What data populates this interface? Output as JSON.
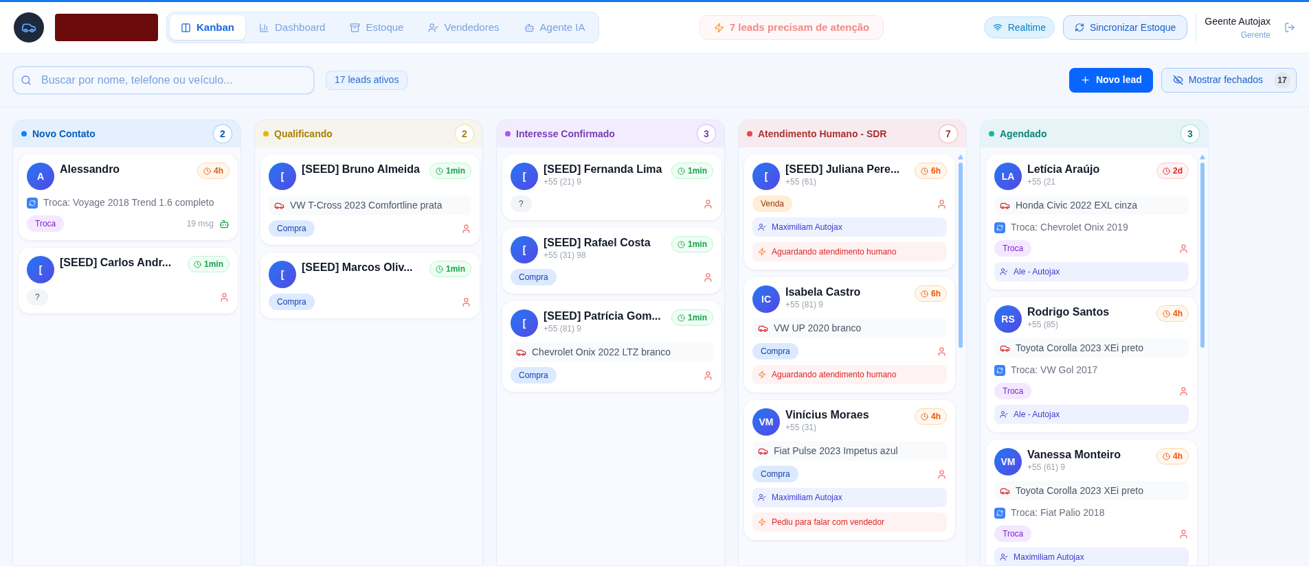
{
  "header": {
    "tabs": [
      {
        "label": "Kanban",
        "selected": true
      },
      {
        "label": "Dashboard",
        "selected": false
      },
      {
        "label": "Estoque",
        "selected": false
      },
      {
        "label": "Vendedores",
        "selected": false
      },
      {
        "label": "Agente IA",
        "selected": false
      }
    ],
    "alert": "7 leads precisam de atenção",
    "realtime": "Realtime",
    "sync": "Sincronizar Estoque",
    "user": {
      "name": "Geente Autojax",
      "role": "Gerente"
    }
  },
  "toolbar": {
    "search": {
      "placeholder": "Buscar por nome, telefone ou veículo..."
    },
    "active_count": "17 leads ativos",
    "new_lead": "Novo lead",
    "show_closed": {
      "label": "Mostrar fechados",
      "count": "17"
    }
  },
  "columns": [
    {
      "title": "Novo Contato",
      "count": "2",
      "color": "#0a84ff",
      "scrollable": false,
      "cards": [
        {
          "kind": "bot",
          "initials": "A",
          "name": "Alessandro",
          "time": {
            "label": "4h",
            "kind": "warn"
          },
          "trade": "Troca: Voyage 2018 Trend 1.6 completo",
          "tag": {
            "label": "Troca",
            "kind": "troca"
          },
          "msgs": "19 msg"
        },
        {
          "kind": "person",
          "initials": "[",
          "name": "[SEED] Carlos Andr...",
          "time": {
            "label": "1min",
            "kind": "ok"
          },
          "tag": {
            "label": "?",
            "kind": "unknown"
          }
        }
      ]
    },
    {
      "title": "Qualificando",
      "count": "2",
      "color": "#eab308",
      "scrollable": false,
      "cards": [
        {
          "kind": "person",
          "initials": "[",
          "name": "[SEED] Bruno Almeida",
          "time": {
            "label": "1min",
            "kind": "ok"
          },
          "vehicle": "VW T-Cross 2023 Comfortline prata",
          "tag": {
            "label": "Compra",
            "kind": "compra"
          }
        },
        {
          "kind": "person",
          "initials": "[",
          "name": "[SEED] Marcos Oliv...",
          "time": {
            "label": "1min",
            "kind": "ok"
          },
          "tag": {
            "label": "Compra",
            "kind": "compra"
          }
        }
      ]
    },
    {
      "title": "Interesse Confirmado",
      "count": "3",
      "color": "#a855f7",
      "scrollable": false,
      "cards": [
        {
          "kind": "person",
          "initials": "[",
          "name": "[SEED] Fernanda Lima",
          "phone": "+55 (21) 9",
          "time": {
            "label": "1min",
            "kind": "ok"
          },
          "tag": {
            "label": "?",
            "kind": "unknown"
          }
        },
        {
          "kind": "person",
          "initials": "[",
          "name": "[SEED] Rafael Costa",
          "phone": "+55 (31) 98",
          "time": {
            "label": "1min",
            "kind": "ok"
          },
          "tag": {
            "label": "Compra",
            "kind": "compra"
          }
        },
        {
          "kind": "person",
          "initials": "[",
          "name": "[SEED] Patrícia Gom...",
          "phone": "+55 (81) 9",
          "time": {
            "label": "1min",
            "kind": "ok"
          },
          "vehicle": "Chevrolet Onix 2022 LTZ branco",
          "tag": {
            "label": "Compra",
            "kind": "compra"
          }
        }
      ]
    },
    {
      "title": "Atendimento Humano - SDR",
      "count": "7",
      "color": "#ef4444",
      "scrollable": true,
      "cards": [
        {
          "kind": "person",
          "initials": "[",
          "name": "[SEED] Juliana Pere...",
          "phone": "+55 (61)",
          "time": {
            "label": "6h",
            "kind": "warn"
          },
          "tag": {
            "label": "Venda",
            "kind": "venda"
          },
          "seller": "Maximiliam Autojax",
          "alert": "Aguardando atendimento humano"
        },
        {
          "kind": "person",
          "initials": "IC",
          "name": "Isabela Castro",
          "phone": "+55 (81) 9",
          "time": {
            "label": "6h",
            "kind": "warn"
          },
          "vehicle": "VW UP 2020 branco",
          "tag": {
            "label": "Compra",
            "kind": "compra"
          },
          "alert": "Aguardando atendimento humano"
        },
        {
          "kind": "person",
          "initials": "VM",
          "name": "Vinícius Moraes",
          "phone": "+55 (31)",
          "time": {
            "label": "4h",
            "kind": "warn"
          },
          "vehicle": "Fiat Pulse 2023 Impetus azul",
          "tag": {
            "label": "Compra",
            "kind": "compra"
          },
          "seller": "Maximiliam Autojax",
          "alert": "Pediu para falar com vendedor"
        }
      ]
    },
    {
      "title": "Agendado",
      "count": "3",
      "color": "#14b8a6",
      "scrollable": true,
      "cards": [
        {
          "kind": "person",
          "initials": "LA",
          "name": "Letícia Araújo",
          "phone": "+55 (21",
          "time": {
            "label": "2d",
            "kind": "late"
          },
          "vehicle": "Honda Civic 2022 EXL cinza",
          "trade": "Troca: Chevrolet Onix 2019",
          "tag": {
            "label": "Troca",
            "kind": "troca"
          },
          "seller": "Ale - Autojax"
        },
        {
          "kind": "person",
          "initials": "RS",
          "name": "Rodrigo Santos",
          "phone": "+55 (85)",
          "time": {
            "label": "4h",
            "kind": "warn"
          },
          "vehicle": "Toyota Corolla 2023 XEi preto",
          "trade": "Troca: VW Gol 2017",
          "tag": {
            "label": "Troca",
            "kind": "troca"
          },
          "seller": "Ale - Autojax"
        },
        {
          "kind": "person",
          "initials": "VM",
          "name": "Vanessa Monteiro",
          "phone": "+55 (61) 9",
          "time": {
            "label": "4h",
            "kind": "warn"
          },
          "vehicle": "Toyota Corolla 2023 XEi preto",
          "trade": "Troca: Fiat Palio 2018",
          "tag": {
            "label": "Troca",
            "kind": "troca"
          },
          "seller": "Maximiliam Autojax"
        }
      ]
    }
  ]
}
